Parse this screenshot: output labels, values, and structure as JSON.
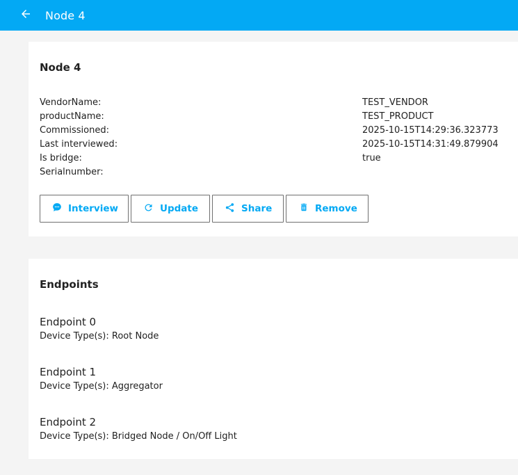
{
  "header": {
    "title": "Node 4",
    "back_icon": "arrow-left-icon",
    "background": "#03a9f4"
  },
  "node_card": {
    "title": "Node 4",
    "info": [
      {
        "label": "VendorName:",
        "value": "TEST_VENDOR"
      },
      {
        "label": "productName:",
        "value": "TEST_PRODUCT"
      },
      {
        "label": "Commissioned:",
        "value": "2025-10-15T14:29:36.323773"
      },
      {
        "label": "Last interviewed:",
        "value": "2025-10-15T14:31:49.879904"
      },
      {
        "label": "Is bridge:",
        "value": "true"
      },
      {
        "label": "Serialnumber:",
        "value": ""
      }
    ],
    "actions": {
      "interview": {
        "label": "Interview",
        "icon": "message-icon"
      },
      "update": {
        "label": "Update",
        "icon": "refresh-icon"
      },
      "share": {
        "label": "Share",
        "icon": "share-icon"
      },
      "remove": {
        "label": "Remove",
        "icon": "trash-icon"
      }
    },
    "accent": "#03a9f4"
  },
  "endpoints_card": {
    "title": "Endpoints",
    "endpoints": [
      {
        "name": "Endpoint 0",
        "types": "Device Type(s): Root Node"
      },
      {
        "name": "Endpoint 1",
        "types": "Device Type(s): Aggregator"
      },
      {
        "name": "Endpoint 2",
        "types": "Device Type(s): Bridged Node / On/Off Light"
      }
    ]
  }
}
